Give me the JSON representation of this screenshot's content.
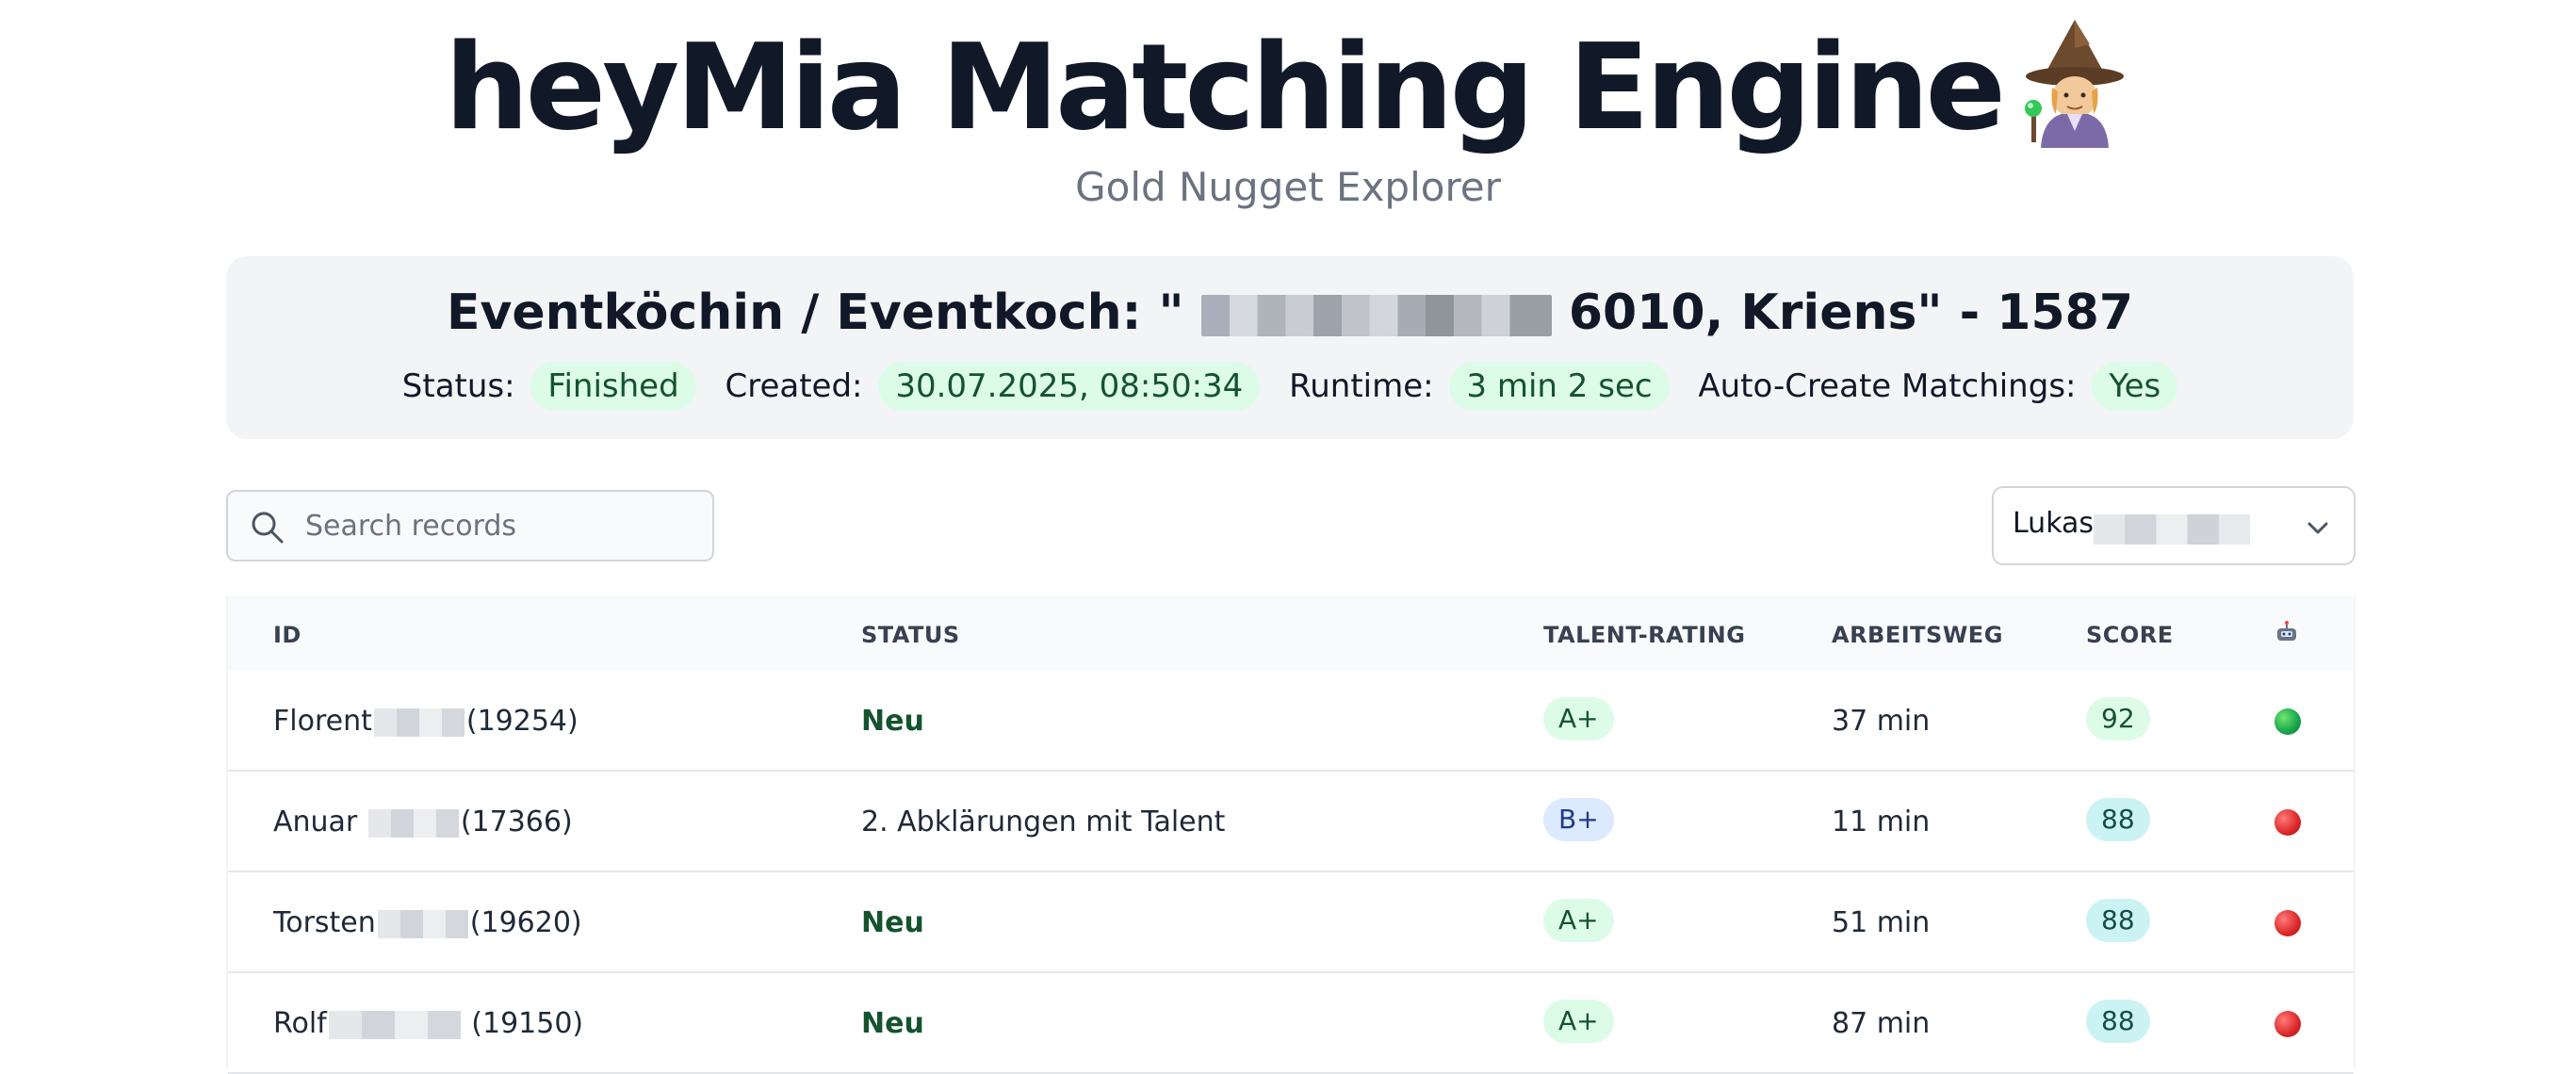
{
  "header": {
    "title": "heyMia Matching Engine",
    "title_icon": "wizard-emoji",
    "subtitle": "Gold Nugget Explorer"
  },
  "job": {
    "title_prefix": "Eventköchin / Eventkoch: \"",
    "title_suffix": "6010, Kriens\" - 1587",
    "status_label": "Status:",
    "status_value": "Finished",
    "created_label": "Created:",
    "created_value": "30.07.2025, 08:50:34",
    "runtime_label": "Runtime:",
    "runtime_value": "3 min 2 sec",
    "auto_label": "Auto-Create Matchings:",
    "auto_value": "Yes"
  },
  "search": {
    "placeholder": "Search records",
    "icon": "search-icon"
  },
  "user_filter": {
    "selected": "Lukas",
    "icon": "chevron-down-icon"
  },
  "table": {
    "columns": [
      "ID",
      "STATUS",
      "TALENT-RATING",
      "ARBEITSWEG",
      "SCORE",
      "bot-icon"
    ],
    "rows": [
      {
        "name": "Florent",
        "id": "(19254)",
        "status": "Neu",
        "status_new": true,
        "rating": "A+",
        "commute": "37 min",
        "score": "92",
        "indicator": "green"
      },
      {
        "name": "Anuar",
        "id": "(17366)",
        "status": "2. Abklärungen mit Talent",
        "status_new": false,
        "rating": "B+",
        "commute": "11 min",
        "score": "88",
        "indicator": "red"
      },
      {
        "name": "Torsten",
        "id": "(19620)",
        "status": "Neu",
        "status_new": true,
        "rating": "A+",
        "commute": "51 min",
        "score": "88",
        "indicator": "red"
      },
      {
        "name": "Rolf",
        "id": "(19150)",
        "status": "Neu",
        "status_new": true,
        "rating": "A+",
        "commute": "87 min",
        "score": "88",
        "indicator": "red"
      }
    ]
  },
  "colors": {
    "accent_underline": "#b2638f",
    "pill_green_bg": "#dcfce7",
    "pill_blue_bg": "#dbeafe",
    "pill_teal_bg": "#ccf3f3",
    "indicator_green": "#16a34a",
    "indicator_red": "#dc2626"
  }
}
